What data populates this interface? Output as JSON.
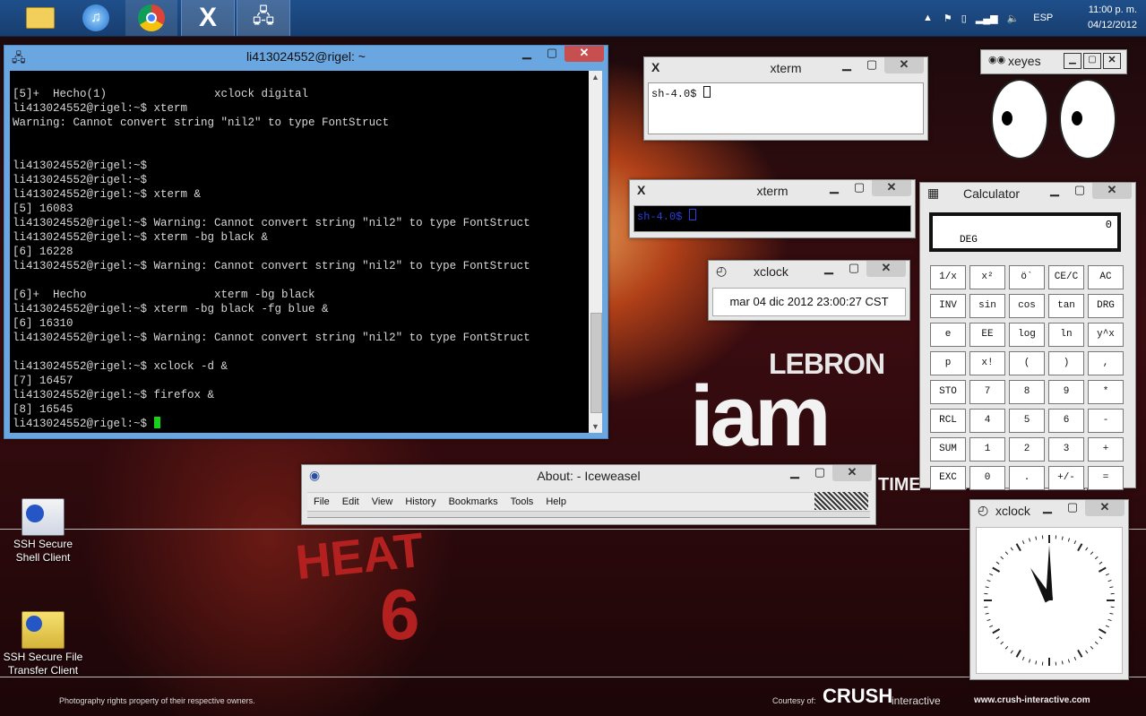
{
  "taskbar": {
    "apps": [
      {
        "name": "file-explorer",
        "icon": "folder-icon"
      },
      {
        "name": "itunes",
        "icon": "music-icon"
      },
      {
        "name": "chrome",
        "icon": "chrome-icon"
      },
      {
        "name": "xming",
        "icon": "x-icon"
      },
      {
        "name": "ssh-client",
        "icon": "network-icon"
      }
    ],
    "language": "ESP",
    "time": "11:00 p. m.",
    "date": "04/12/2012"
  },
  "ssh_window": {
    "title": "li413024552@rigel: ~",
    "lines": [
      "[5]+  Hecho(1)                xclock digital",
      "li413024552@rigel:~$ xterm",
      "Warning: Cannot convert string \"nil2\" to type FontStruct",
      "",
      "",
      "li413024552@rigel:~$",
      "li413024552@rigel:~$",
      "li413024552@rigel:~$ xterm &",
      "[5] 16083",
      "li413024552@rigel:~$ Warning: Cannot convert string \"nil2\" to type FontStruct",
      "li413024552@rigel:~$ xterm -bg black &",
      "[6] 16228",
      "li413024552@rigel:~$ Warning: Cannot convert string \"nil2\" to type FontStruct",
      "",
      "[6]+  Hecho                   xterm -bg black",
      "li413024552@rigel:~$ xterm -bg black -fg blue &",
      "[6] 16310",
      "li413024552@rigel:~$ Warning: Cannot convert string \"nil2\" to type FontStruct",
      "",
      "li413024552@rigel:~$ xclock -d &",
      "[7] 16457",
      "li413024552@rigel:~$ firefox &",
      "[8] 16545"
    ],
    "prompt": "li413024552@rigel:~$ "
  },
  "xterm1": {
    "title": "xterm",
    "text": "sh-4.0$"
  },
  "xterm2": {
    "title": "xterm",
    "text": "sh-4.0$"
  },
  "xeyes": {
    "title": "xeyes"
  },
  "xclock_digital": {
    "title": "xclock",
    "time": "mar 04 dic 2012 23:00:27 CST"
  },
  "calculator": {
    "title": "Calculator",
    "display": "0",
    "mode": "DEG",
    "keys": [
      "1/x",
      "x²",
      "ö`",
      "CE/C",
      "AC",
      "INV",
      "sin",
      "cos",
      "tan",
      "DRG",
      "e",
      "EE",
      "log",
      "ln",
      "y^x",
      "p",
      "x!",
      "(",
      ")",
      ",",
      "STO",
      "7",
      "8",
      "9",
      "*",
      "RCL",
      "4",
      "5",
      "6",
      "-",
      "SUM",
      "1",
      "2",
      "3",
      "+",
      "EXC",
      "0",
      ".",
      "+/-",
      "="
    ]
  },
  "xclock_analog": {
    "title": "xclock",
    "hour": 23,
    "minute": 0
  },
  "iceweasel": {
    "title": "About: - Iceweasel",
    "menu": [
      {
        "label": "File",
        "accel": "F"
      },
      {
        "label": "Edit",
        "accel": "E"
      },
      {
        "label": "View",
        "accel": "V"
      },
      {
        "label": "History",
        "accel": "s"
      },
      {
        "label": "Bookmarks",
        "accel": "B"
      },
      {
        "label": "Tools",
        "accel": "T"
      },
      {
        "label": "Help",
        "accel": "H"
      }
    ]
  },
  "desktop_icons": [
    {
      "label": "SSH Secure Shell Client",
      "icon": "ssh-shell-icon"
    },
    {
      "label": "SSH Secure File Transfer Client",
      "icon": "ssh-file-transfer-icon"
    }
  ],
  "wallpaper": {
    "lebron": "LEBRON",
    "iam": "iam",
    "tagline": "TIME TO BRING THE HEAT",
    "credit": "Photography rights property of their respective owners.",
    "courtesy": "Courtesy of:",
    "brand": "CRUSH",
    "brand_sub": "interactive",
    "url": "www.crush-interactive.com",
    "jersey_text": "HEAT",
    "jersey_number": "6"
  },
  "colors": {
    "taskbar": "#1f4f8a",
    "ssh_frame": "#6aa6e0",
    "close": "#c74f4f",
    "cursor": "#18d018",
    "xterm2_fg": "#2a3fe0"
  }
}
